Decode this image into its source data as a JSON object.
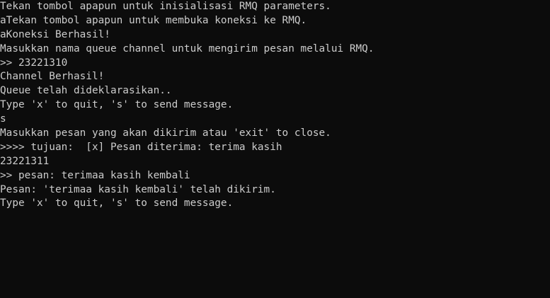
{
  "console": {
    "lines": [
      "Tekan tombol apapun untuk inisialisasi RMQ parameters.",
      "aTekan tombol apapun untuk membuka koneksi ke RMQ.",
      "aKoneksi Berhasil!",
      "Masukkan nama queue channel untuk mengirim pesan melalui RMQ.",
      ">> 23221310",
      "Channel Berhasil!",
      "Queue telah dideklarasikan..",
      "Type 'x' to quit, 's' to send message.",
      "s",
      "Masukkan pesan yang akan dikirim atau 'exit' to close.",
      ">>>> tujuan:  [x] Pesan diterima: terima kasih",
      "23221311",
      ">> pesan: terimaa kasih kembali",
      "Pesan: 'terimaa kasih kembali' telah dikirim.",
      "Type 'x' to quit, 's' to send message."
    ]
  }
}
